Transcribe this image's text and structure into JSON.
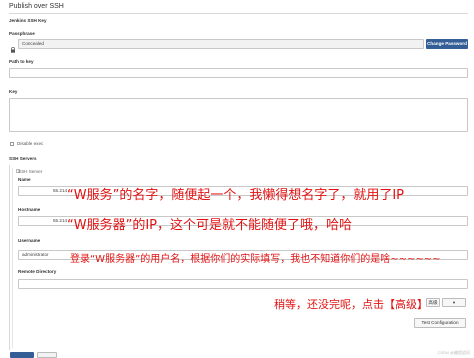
{
  "section": {
    "title": "Publish over SSH"
  },
  "jenkins_ssh_key": {
    "label": "Jenkins SSH Key"
  },
  "passphrase": {
    "label": "Passphrase",
    "value": "Concealed",
    "change_button": "Change Password"
  },
  "path_to_key": {
    "label": "Path to key"
  },
  "key": {
    "label": "Key"
  },
  "disable_exec": {
    "label": "Disable exec"
  },
  "ssh_servers": {
    "label": "SSH Servers"
  },
  "ssh_server": {
    "sublabel": "SSH Server",
    "name_label": "Name",
    "name_value": "55.214",
    "hostname_label": "Hostname",
    "hostname_value": "55.214",
    "username_label": "Username",
    "username_value": "administrator",
    "remote_dir_label": "Remote Directory",
    "advanced_button": "高级",
    "test_button": "Test Configuration"
  },
  "annotations": {
    "name": "“W服务”的名字，随便起一个，我懒得想名字了，就用了IP",
    "hostname": "“W服务器”的IP，这个可是就不能随便了哦，哈哈",
    "username": "登录“W服务器”的用户名，根据你们的实际填写，我也不知道你们的是啥~~~~~~",
    "advanced": "稍等，还没完呢，点击【高级】"
  },
  "watermark": "CSDN @编程追风"
}
